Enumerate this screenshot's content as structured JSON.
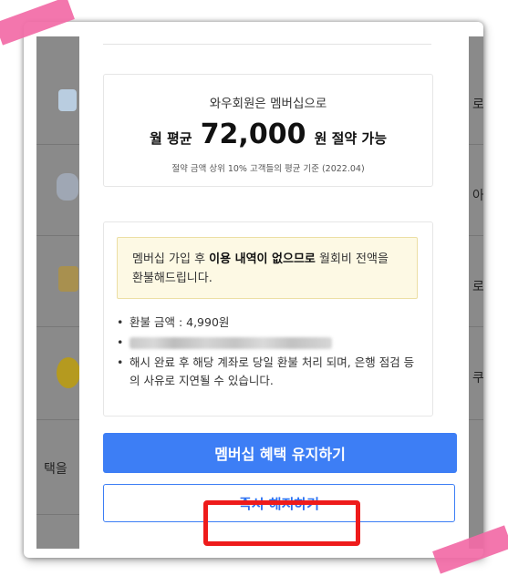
{
  "savings_card": {
    "intro": "와우회원은 멤버십으로",
    "monthly_prefix": "월 평균",
    "amount": "72,000",
    "monthly_suffix": "원 절약 가능",
    "note": "절약 금액 상위 10% 고객들의 평균 기준 (2022.04)"
  },
  "refund_card": {
    "notice_before": "멤버십 가입 후 ",
    "notice_bold": "이용 내역이 없으므로",
    "notice_after": " 월회비 전액을 환불해드립니다.",
    "bullets": [
      "환불 금액 : 4,990원",
      "",
      "해시 완료 후 해당 계좌로 당일 환불 처리 되며, 은행 점검 등의 사유로 지연될 수 있습니다."
    ]
  },
  "buttons": {
    "keep": "멤버십 혜택 유지하기",
    "cancel": "즉시 해지하기"
  },
  "background_page": {
    "right_items": [
      "로켓프",
      "아침",
      "로켓배",
      "쿠팡플"
    ],
    "left_items": [
      "택을"
    ]
  },
  "colors": {
    "primary": "#3d7ef5",
    "annotation_red": "#ee1b1b",
    "tape_pink": "#f26aa6",
    "notice_bg": "#fdf9e4"
  }
}
